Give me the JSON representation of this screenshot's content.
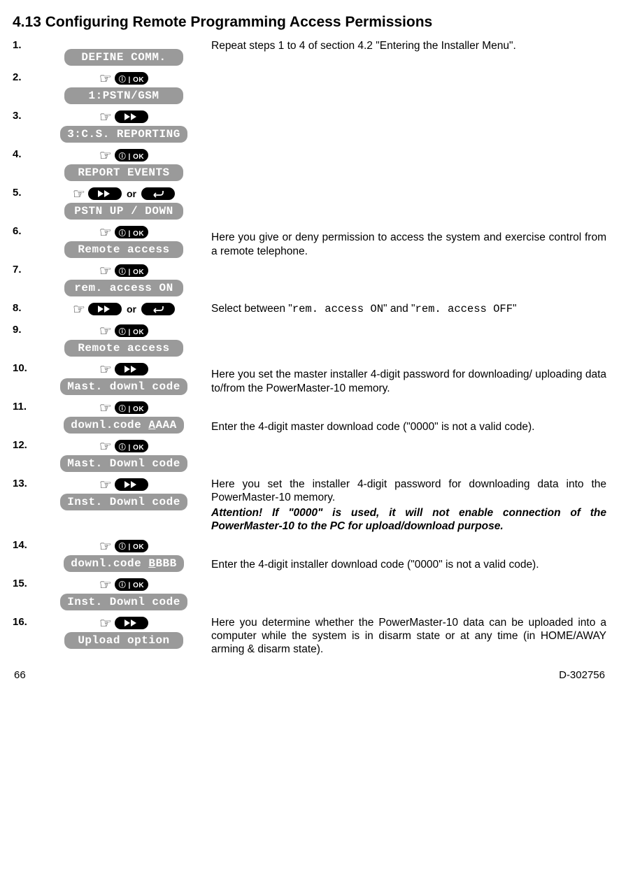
{
  "title": "4.13 Configuring Remote Programming Access Permissions",
  "intro": "Repeat steps 1 to 4 of section 4.2 \"Entering the Installer Menu\".",
  "steps": {
    "s1_lcd": "DEFINE COMM.",
    "s2_lcd": "1:PSTN/GSM",
    "s3_lcd": "3:C.S. REPORTING",
    "s4_lcd": "REPORT EVENTS",
    "s5_lcd": "PSTN UP / DOWN",
    "s6_lcd": "Remote access",
    "s6_desc": "Here you give or deny permission to access the system and exercise control from a remote telephone.",
    "s7_lcd": "rem. access ON",
    "s8_desc_a": "Select between \"",
    "s8_code_a": "rem. access ON",
    "s8_desc_b": "\" and \"",
    "s8_code_b": "rem. access OFF",
    "s8_desc_c": "\"",
    "s9_lcd": "Remote access",
    "s10_lcd": "Mast. downl code",
    "s10_desc": "Here you set the master installer 4-digit password for downloading/ uploading data to/from the PowerMaster-10 memory.",
    "s11_lcd_a": "downl.code ",
    "s11_u": "A",
    "s11_lcd_b": "AAA",
    "s11_desc": "Enter the 4-digit master download code (\"0000\" is not a valid code).",
    "s12_lcd": "Mast. Downl code",
    "s13_lcd": "Inst. Downl code",
    "s13_desc": "Here you set the installer 4-digit password for downloading data into the PowerMaster-10 memory.",
    "s13_warn": "Attention! If \"0000\" is used, it will not enable connection of the PowerMaster-10 to the PC for upload/download purpose.",
    "s14_lcd_a": "downl.code ",
    "s14_u": "B",
    "s14_lcd_b": "BBB",
    "s14_desc": "Enter the 4-digit installer download code (\"0000\" is not a valid code).",
    "s15_lcd": "Inst. Downl code",
    "s16_lcd": "Upload option",
    "s16_desc": "Here you determine whether the PowerMaster-10 data can be uploaded into a computer while the system is in disarm state or at any time (in HOME/AWAY arming & disarm state)."
  },
  "or_label": "or",
  "footer": {
    "page": "66",
    "doc": "D-302756"
  }
}
